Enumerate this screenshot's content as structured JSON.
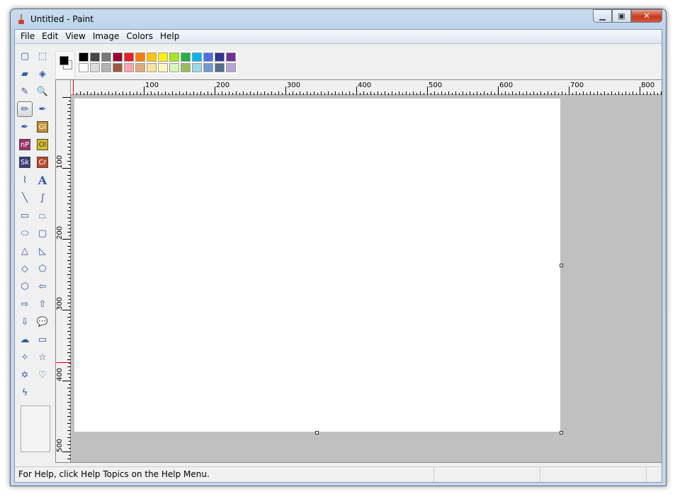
{
  "window": {
    "title": "Untitled - Paint"
  },
  "menu": [
    "File",
    "Edit",
    "View",
    "Image",
    "Colors",
    "Help"
  ],
  "tools": [
    [
      "free-form-select",
      "▢",
      "rect-select",
      "⬚"
    ],
    [
      "eraser",
      "▰",
      "fill-bucket",
      "◈"
    ],
    [
      "color-picker",
      "✎",
      "magnifier",
      "🔍"
    ],
    [
      "pencil",
      "✏",
      "brush",
      "✒"
    ],
    [
      "brush-alt",
      "✒",
      "Gl",
      "Gl"
    ],
    [
      "nP",
      "nP",
      "Ol",
      "Ol"
    ],
    [
      "Sk",
      "Sk",
      "Cr",
      "Cr"
    ],
    [
      "airbrush",
      "⌇",
      "text",
      "A"
    ],
    [
      "line",
      "╲",
      "curve",
      "∫"
    ],
    [
      "rectangle",
      "▭",
      "polygon",
      "⏢"
    ],
    [
      "ellipse",
      "⬭",
      "rounded-rectangle",
      "▢"
    ],
    [
      "triangle",
      "△",
      "right-triangle",
      "◺"
    ],
    [
      "diamond",
      "◇",
      "pentagon",
      "⬠"
    ],
    [
      "hexagon",
      "⬡",
      "left-arrow",
      "⇦"
    ],
    [
      "right-arrow",
      "⇨",
      "up-arrow",
      "⇧"
    ],
    [
      "down-arrow",
      "⇩",
      "oval-callout",
      "💬"
    ],
    [
      "cloud-callout",
      "☁",
      "rect-callout",
      "▭"
    ],
    [
      "four-point-star",
      "✧",
      "five-point-star",
      "☆"
    ],
    [
      "six-point-star",
      "✡",
      "heart",
      "♡"
    ],
    [
      "lightning",
      "ϟ"
    ]
  ],
  "badges": {
    "Gl": "#c8902a",
    "nP": "#a0306e",
    "Ol": "#d8c020",
    "Sk": "#3a3a7a",
    "Cr": "#c04a2a"
  },
  "colors": {
    "foreground": "#000000",
    "background": "#FFFFFF"
  },
  "palette": [
    "#000000",
    "#464646",
    "#787878",
    "#990030",
    "#ED1C24",
    "#FF7E00",
    "#FFC20E",
    "#FFF200",
    "#A8E61D",
    "#22B14C",
    "#00B7EF",
    "#4D6DF3",
    "#2F3699",
    "#6F3198",
    "#FFFFFF",
    "#DCDCDC",
    "#B4B4B4",
    "#9C5A3C",
    "#FFA3B1",
    "#E5AA7A",
    "#F5E49C",
    "#FFF9BD",
    "#D3F9BC",
    "#9DBB61",
    "#99D9EA",
    "#709AD1",
    "#546D8E",
    "#B5A5D5"
  ],
  "ruler": {
    "top_labels": [
      "100",
      "200",
      "300",
      "400",
      "500",
      "600",
      "700",
      "800"
    ],
    "left_labels": [
      "100",
      "200",
      "300",
      "400",
      "500"
    ]
  },
  "status": {
    "help": "For Help, click Help Topics on the Help Menu."
  }
}
